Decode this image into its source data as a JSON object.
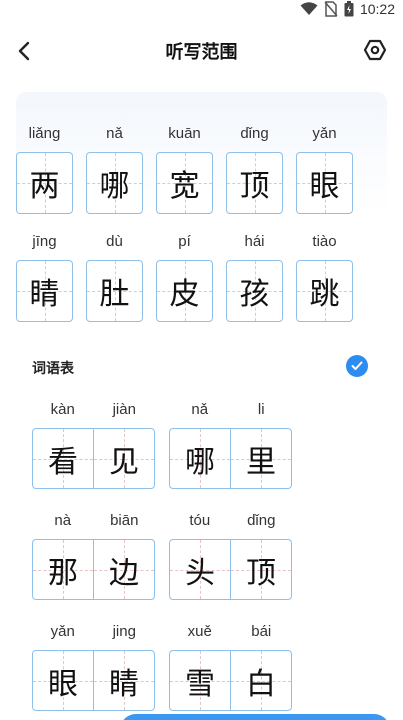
{
  "status_bar": {
    "time": "10:22"
  },
  "header": {
    "title": "听写范围"
  },
  "characters": [
    [
      {
        "pinyin": "liǎng",
        "char": "两"
      },
      {
        "pinyin": "nǎ",
        "char": "哪"
      },
      {
        "pinyin": "kuān",
        "char": "宽"
      },
      {
        "pinyin": "dǐng",
        "char": "顶"
      },
      {
        "pinyin": "yǎn",
        "char": "眼"
      }
    ],
    [
      {
        "pinyin": "jīng",
        "char": "睛"
      },
      {
        "pinyin": "dù",
        "char": "肚"
      },
      {
        "pinyin": "pí",
        "char": "皮"
      },
      {
        "pinyin": "hái",
        "char": "孩"
      },
      {
        "pinyin": "tiào",
        "char": "跳"
      }
    ]
  ],
  "word_section": {
    "title": "词语表",
    "checked": true
  },
  "words": [
    [
      {
        "pinyin": [
          "kàn",
          "jiàn"
        ],
        "chars": [
          "看",
          "见"
        ]
      },
      {
        "pinyin": [
          "nǎ",
          "li"
        ],
        "chars": [
          "哪",
          "里"
        ]
      }
    ],
    [
      {
        "pinyin": [
          "nà",
          "biān"
        ],
        "chars": [
          "那",
          "边"
        ]
      },
      {
        "pinyin": [
          "tóu",
          "dǐng"
        ],
        "chars": [
          "头",
          "顶"
        ]
      }
    ],
    [
      {
        "pinyin": [
          "yǎn",
          "jing"
        ],
        "chars": [
          "眼",
          "睛"
        ]
      },
      {
        "pinyin": [
          "xuě",
          "bái"
        ],
        "chars": [
          "雪",
          "白"
        ]
      }
    ]
  ],
  "colors": {
    "accent": "#2d8cf0",
    "grid_border": "#8fc0ea",
    "guide_line": "#e6c4c4"
  }
}
